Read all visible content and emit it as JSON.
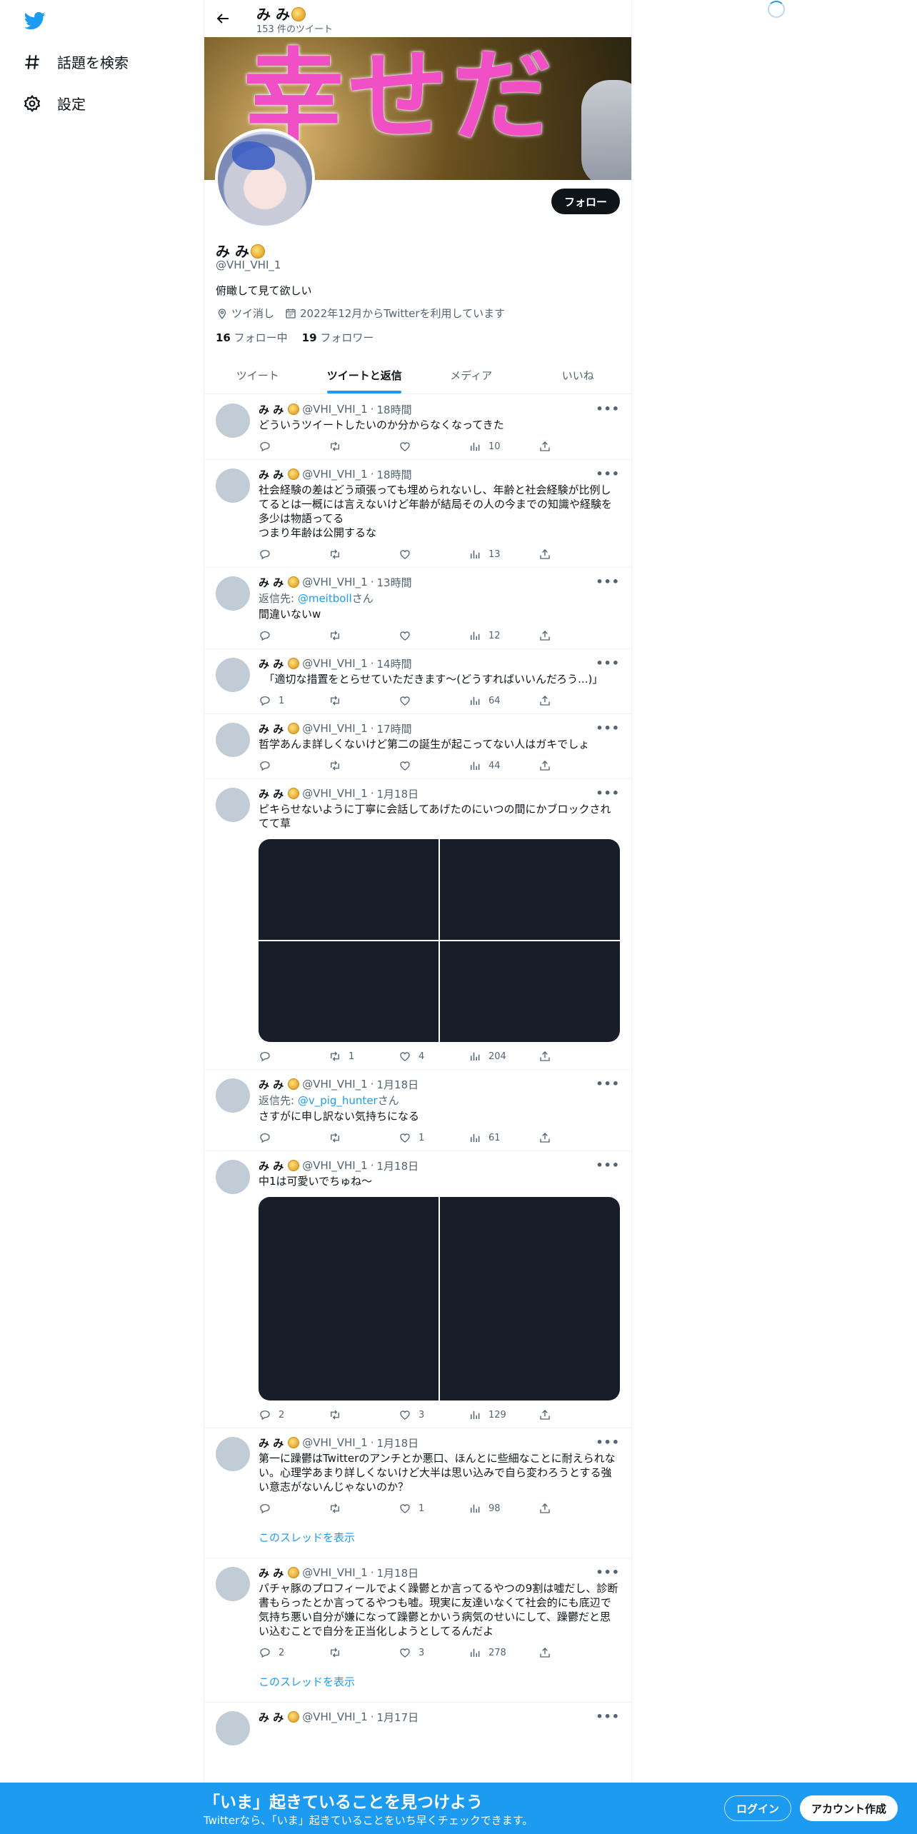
{
  "colors": {
    "accent": "#1d9bf0",
    "text": "#0f1419",
    "muted": "#536471",
    "media": "#171e29"
  },
  "sidebar": {
    "logo_icon": "twitter-bird-icon",
    "items": [
      {
        "icon": "hashtag-icon",
        "label": "話題を検索"
      },
      {
        "icon": "gear-icon",
        "label": "設定"
      }
    ]
  },
  "header": {
    "name": "み み",
    "tweet_count": "153 件のツイート"
  },
  "banner": {
    "text": "幸せだ"
  },
  "profile": {
    "follow_label": "フォロー",
    "name": "み み",
    "handle": "@VHI_VHI_1",
    "bio": "俯瞰して見て欲しい",
    "location": "ツイ消し",
    "joined": "2022年12月からTwitterを利用しています",
    "following_count": "16",
    "following_label": "フォロー中",
    "followers_count": "19",
    "followers_label": "フォロワー"
  },
  "tabs": [
    "ツイート",
    "ツイートと返信",
    "メディア",
    "いいね"
  ],
  "tweets": [
    {
      "name": "み み",
      "handle": "@VHI_VHI_1",
      "time": "18時間",
      "text": "どういうツイートしたいのか分からなくなってきた",
      "replies": "",
      "retweets": "",
      "likes": "",
      "views": "10"
    },
    {
      "name": "み み",
      "handle": "@VHI_VHI_1",
      "time": "18時間",
      "text": "社会経験の差はどう頑張っても埋められないし、年齢と社会経験が比例してるとは一概には言えないけど年齢が結局その人の今までの知識や経験を多少は物語ってる\nつまり年齢は公開するな",
      "replies": "",
      "retweets": "",
      "likes": "",
      "views": "13"
    },
    {
      "name": "み み",
      "handle": "@VHI_VHI_1",
      "time": "13時間",
      "reply_prefix": "返信先: ",
      "reply_to": "@meitboll",
      "reply_suffix": "さん",
      "text": "間違いないw",
      "replies": "",
      "retweets": "",
      "likes": "",
      "views": "12"
    },
    {
      "name": "み み",
      "handle": "@VHI_VHI_1",
      "time": "14時間",
      "text": "　「適切な措置をとらせていただきます～(どうすればいいんだろう...)」",
      "replies": "1",
      "retweets": "",
      "likes": "",
      "views": "64"
    },
    {
      "name": "み み",
      "handle": "@VHI_VHI_1",
      "time": "17時間",
      "text": "哲学あんま詳しくないけど第二の誕生が起こってない人はガキでしょ",
      "replies": "",
      "retweets": "",
      "likes": "",
      "views": "44"
    },
    {
      "name": "み み",
      "handle": "@VHI_VHI_1",
      "time": "1月18日",
      "text": "ピキらせないように丁寧に会話してあげたのにいつの間にかブロックされてて草",
      "media": "quad",
      "replies": "",
      "retweets": "1",
      "likes": "4",
      "views": "204"
    },
    {
      "name": "み み",
      "handle": "@VHI_VHI_1",
      "time": "1月18日",
      "reply_prefix": "返信先: ",
      "reply_to": "@v_pig_hunter",
      "reply_suffix": "さん",
      "text": "さすがに申し訳ない気持ちになる",
      "replies": "",
      "retweets": "",
      "likes": "1",
      "views": "61"
    },
    {
      "name": "み み",
      "handle": "@VHI_VHI_1",
      "time": "1月18日",
      "text": "中1は可愛いでちゅね〜",
      "media": "double",
      "replies": "2",
      "retweets": "",
      "likes": "3",
      "views": "129"
    },
    {
      "name": "み み",
      "handle": "@VHI_VHI_1",
      "time": "1月18日",
      "text": "第一に躁鬱はTwitterのアンチとか悪口、ほんとに些細なことに耐えられない。心理学あまり詳しくないけど大半は思い込みで自ら変わろうとする強い意志がないんじゃないのか？",
      "replies": "",
      "retweets": "",
      "likes": "1",
      "views": "98",
      "thread_link": "このスレッドを表示"
    },
    {
      "name": "み み",
      "handle": "@VHI_VHI_1",
      "time": "1月18日",
      "text": "パチャ豚のプロフィールでよく躁鬱とか言ってるやつの9割は嘘だし、診断書もらったとか言ってるやつも嘘。現実に友達いなくて社会的にも底辺で気持ち悪い自分が嫌になって躁鬱とかいう病気のせいにして、躁鬱だと思い込むことで自分を正当化しようとしてるんだよ",
      "replies": "2",
      "retweets": "",
      "likes": "3",
      "views": "278",
      "thread_link": "このスレッドを表示"
    },
    {
      "name": "み み",
      "handle": "@VHI_VHI_1",
      "time": "1月17日",
      "text": "",
      "replies": "",
      "retweets": "",
      "likes": "",
      "views": ""
    }
  ],
  "bottom_bar": {
    "title": "「いま」起きていることを見つけよう",
    "subtitle": "Twitterなら、「いま」起きていることをいち早くチェックできます。",
    "login_label": "ログイン",
    "signup_label": "アカウント作成"
  }
}
